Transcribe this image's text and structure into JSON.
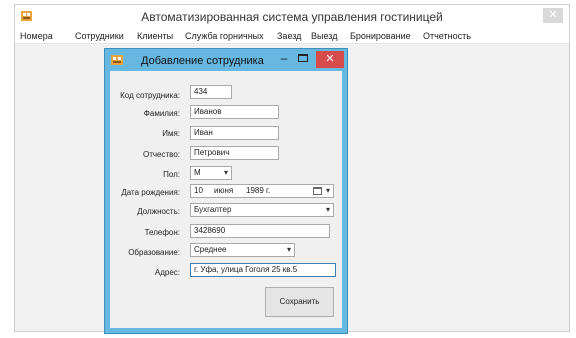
{
  "main_window": {
    "title": "Автоматизированная система управления гостиницей",
    "close_glyph": "✕"
  },
  "menu": [
    {
      "label": "Номера"
    },
    {
      "label": "Сотрудники"
    },
    {
      "label": "Клиенты"
    },
    {
      "label": "Служба горничных"
    },
    {
      "label": "Заезд"
    },
    {
      "label": "Выезд"
    },
    {
      "label": "Бронирование"
    },
    {
      "label": "Отчетность"
    }
  ],
  "dialog": {
    "title": "Добавление сотрудника",
    "min_glyph": "–",
    "close_glyph": "✕",
    "accent_color": "#67b8e0",
    "close_color": "#d84b4b",
    "fields": {
      "employee_code": {
        "label": "Код сотрудника:",
        "value": "434"
      },
      "last_name": {
        "label": "Фамилия:",
        "value": "Иванов"
      },
      "first_name": {
        "label": "Имя:",
        "value": "Иван"
      },
      "patronymic": {
        "label": "Отчество:",
        "value": "Петрович"
      },
      "gender": {
        "label": "Пол:",
        "value": "М"
      },
      "birth_date": {
        "label": "Дата рождения:",
        "day": "10",
        "month": "июня",
        "year": "1989 г."
      },
      "position": {
        "label": "Должность:",
        "value": "Бухгалтер"
      },
      "phone": {
        "label": "Телефон:",
        "value": "3428690"
      },
      "education": {
        "label": "Образование:",
        "value": "Среднее"
      },
      "address": {
        "label": "Адрес:",
        "value": "г. Уфа, улица Гоголя 25 кв.5"
      }
    },
    "save_button": "Сохранить"
  }
}
